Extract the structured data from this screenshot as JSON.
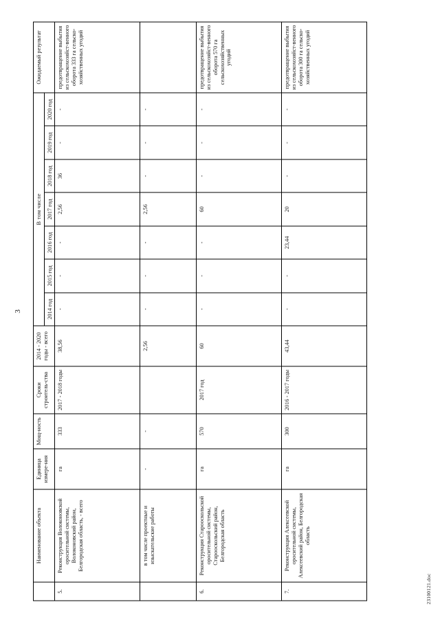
{
  "document": {
    "page_number": "3",
    "footer_filename": "23100121.doc"
  },
  "table": {
    "headers": {
      "number": "",
      "name": "Наименование объекта",
      "unit": "Единица измере-ния",
      "power": "Мощ-ность",
      "terms": "Сроки строитель-ства",
      "total": "2014 - 2020 годы - всего",
      "in_that_number": "В том числе",
      "years": [
        "2014 год",
        "2015 год",
        "2016 год",
        "2017 год",
        "2018 год",
        "2019 год",
        "2020 год"
      ],
      "result": "Ожидаемый результат"
    },
    "rows": [
      {
        "number": "5.",
        "name": "Реконструкция Волоконовской оросительной системы, Волоконовский район, Белгородская область, - всего",
        "unit": "га",
        "power": "333",
        "terms": "2017 - 2018 годы",
        "total": "38,56",
        "years": [
          "-",
          "-",
          "-",
          "2,56",
          "36",
          "-",
          "-"
        ],
        "result": "предотвращение выбытия из сельскохозяйст-венного оборота 333 га сельско-хозяйственных угодий"
      },
      {
        "number": "",
        "name": "в том числе проектные и изыскательские работы",
        "unit": "-",
        "power": "-",
        "terms": "",
        "total": "2,56",
        "years": [
          "-",
          "-",
          "-",
          "2,56",
          "-",
          "-",
          "-"
        ],
        "result": ""
      },
      {
        "number": "6.",
        "name": "Реконструкция Старооскольской оросительной системы, Старооскольский район, Белгородская область",
        "unit": "га",
        "power": "570",
        "terms": "2017 год",
        "total": "60",
        "years": [
          "-",
          "-",
          "-",
          "60",
          "-",
          "-",
          "-"
        ],
        "result": "предотвращение выбытия из сельскохозяйст-венного оборота 570 га сельскохозяйственных угодий"
      },
      {
        "number": "7.",
        "name": "Реконструкция Алексеевской оросительной системы, Алексеевский район, Белгородская область",
        "unit": "га",
        "power": "300",
        "terms": "2016 - 2017 годы",
        "total": "43,44",
        "years": [
          "-",
          "-",
          "23,44",
          "20",
          "-",
          "-",
          "-"
        ],
        "result": "предотвращение выбытия из сельскохозяйст-венного оборота 300 га сельско-хозяйственных угодий"
      }
    ]
  }
}
